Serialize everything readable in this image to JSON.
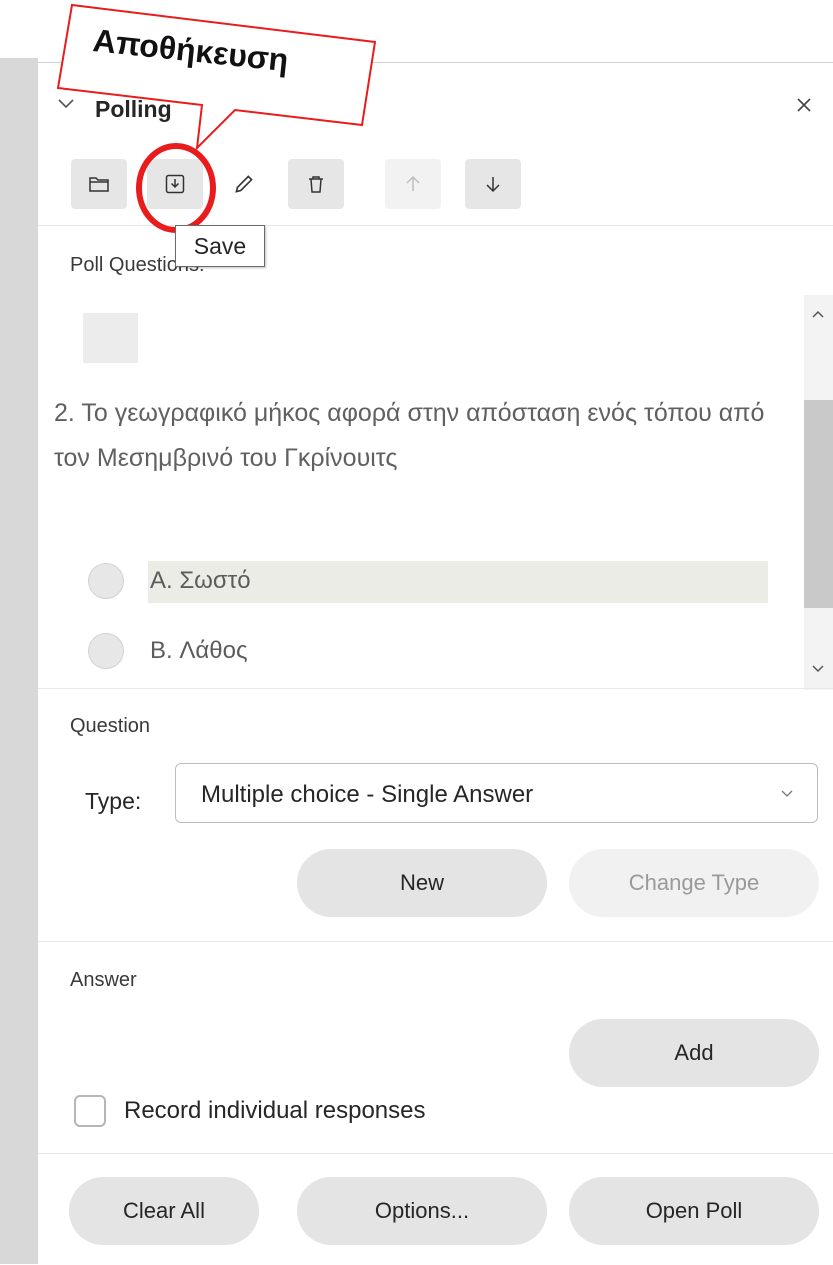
{
  "annotation": {
    "callout_text": "Αποθήκευση",
    "highlight_color": "#e81c1c"
  },
  "header": {
    "title": "Polling",
    "collapse_icon": "chevron-down-icon",
    "close_icon": "close-icon"
  },
  "toolbar": {
    "buttons": [
      {
        "icon": "folder-icon",
        "label": "Open"
      },
      {
        "icon": "save-icon",
        "label": "Save"
      },
      {
        "icon": "pencil-icon",
        "label": "Edit"
      },
      {
        "icon": "trash-icon",
        "label": "Delete"
      },
      {
        "icon": "arrow-up-icon",
        "label": "Move up",
        "enabled": false
      },
      {
        "icon": "arrow-down-icon",
        "label": "Move down"
      }
    ],
    "tooltip": "Save"
  },
  "poll_questions": {
    "label": "Poll Questions:",
    "question_text": "2.  Το γεωγραφικό μήκος αφορά στην απόσταση ενός τόπου από τον Μεσημβρινό του Γκρίνουιτς",
    "options": [
      {
        "label": "A.  Σωστό",
        "selected": true
      },
      {
        "label": "B.  Λάθος",
        "selected": false
      }
    ]
  },
  "question_section": {
    "label": "Question",
    "type_label": "Type:",
    "type_value": "Multiple choice - Single Answer",
    "new_button": "New",
    "change_type_button": "Change Type"
  },
  "answer_section": {
    "label": "Answer",
    "add_button": "Add",
    "record_checkbox_label": "Record individual responses",
    "record_checked": false
  },
  "footer": {
    "clear_all": "Clear All",
    "options": "Options...",
    "open_poll": "Open Poll"
  }
}
